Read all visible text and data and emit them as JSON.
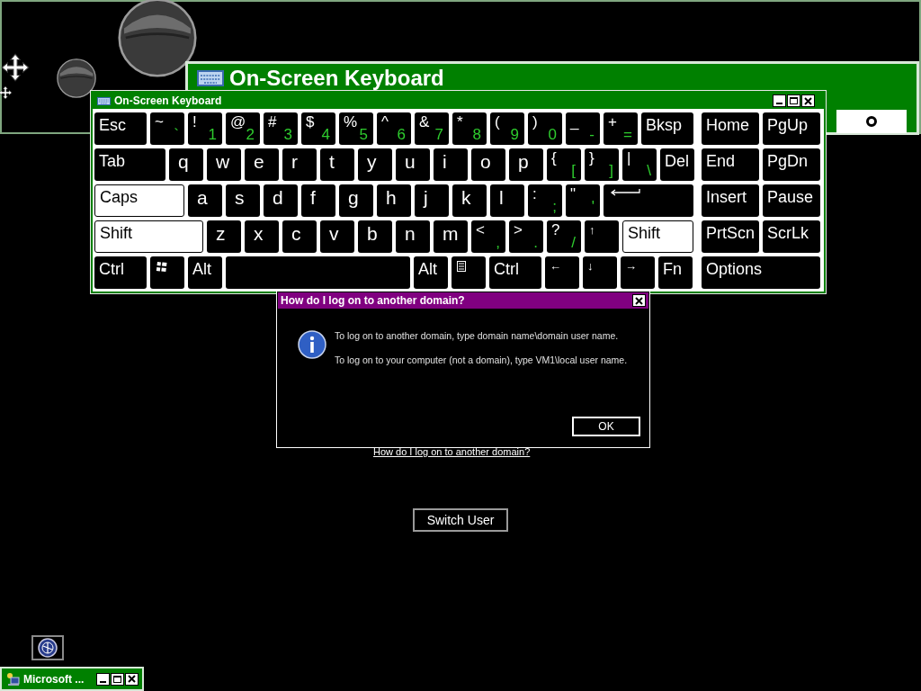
{
  "magnifier": {
    "title": "On-Screen Keyboard"
  },
  "keyboard": {
    "title": "On-Screen Keyboard",
    "main_rows": [
      [
        {
          "kind": "word",
          "label": "Esc",
          "lit": false
        },
        {
          "kind": "dual",
          "shift": "~",
          "base": "`",
          "lit": false
        },
        {
          "kind": "dual",
          "shift": "!",
          "base": "1",
          "lit": false
        },
        {
          "kind": "dual",
          "shift": "@",
          "base": "2",
          "lit": false
        },
        {
          "kind": "dual",
          "shift": "#",
          "base": "3",
          "lit": false
        },
        {
          "kind": "dual",
          "shift": "$",
          "base": "4",
          "lit": false
        },
        {
          "kind": "dual",
          "shift": "%",
          "base": "5",
          "lit": false
        },
        {
          "kind": "dual",
          "shift": "^",
          "base": "6",
          "lit": false
        },
        {
          "kind": "dual",
          "shift": "&",
          "base": "7",
          "lit": false
        },
        {
          "kind": "dual",
          "shift": "*",
          "base": "8",
          "lit": false
        },
        {
          "kind": "dual",
          "shift": "(",
          "base": "9",
          "lit": false
        },
        {
          "kind": "dual",
          "shift": ")",
          "base": "0",
          "lit": false
        },
        {
          "kind": "dual",
          "shift": "_",
          "base": "-",
          "lit": false
        },
        {
          "kind": "dual",
          "shift": "+",
          "base": "=",
          "lit": false
        },
        {
          "kind": "word",
          "label": "Bksp",
          "lit": false
        }
      ],
      [
        {
          "kind": "word",
          "label": "Tab",
          "lit": false
        },
        {
          "kind": "letter",
          "label": "q",
          "lit": false
        },
        {
          "kind": "letter",
          "label": "w",
          "lit": false
        },
        {
          "kind": "letter",
          "label": "e",
          "lit": false
        },
        {
          "kind": "letter",
          "label": "r",
          "lit": false
        },
        {
          "kind": "letter",
          "label": "t",
          "lit": false
        },
        {
          "kind": "letter",
          "label": "y",
          "lit": false
        },
        {
          "kind": "letter",
          "label": "u",
          "lit": false
        },
        {
          "kind": "letter",
          "label": "i",
          "lit": false
        },
        {
          "kind": "letter",
          "label": "o",
          "lit": false
        },
        {
          "kind": "letter",
          "label": "p",
          "lit": false
        },
        {
          "kind": "dual",
          "shift": "{",
          "base": "[",
          "lit": false
        },
        {
          "kind": "dual",
          "shift": "}",
          "base": "]",
          "lit": false
        },
        {
          "kind": "dual",
          "shift": "|",
          "base": "\\",
          "lit": false
        },
        {
          "kind": "word",
          "label": "Del",
          "lit": false
        }
      ],
      [
        {
          "kind": "word",
          "label": "Caps",
          "lit": true
        },
        {
          "kind": "letter",
          "label": "a",
          "lit": false
        },
        {
          "kind": "letter",
          "label": "s",
          "lit": false
        },
        {
          "kind": "letter",
          "label": "d",
          "lit": false
        },
        {
          "kind": "letter",
          "label": "f",
          "lit": false
        },
        {
          "kind": "letter",
          "label": "g",
          "lit": false
        },
        {
          "kind": "letter",
          "label": "h",
          "lit": false
        },
        {
          "kind": "letter",
          "label": "j",
          "lit": false
        },
        {
          "kind": "letter",
          "label": "k",
          "lit": false
        },
        {
          "kind": "letter",
          "label": "l",
          "lit": false
        },
        {
          "kind": "dual",
          "shift": ":",
          "base": ";",
          "lit": false
        },
        {
          "kind": "dual",
          "shift": "\"",
          "base": "'",
          "lit": false
        },
        {
          "kind": "enter",
          "lit": false
        }
      ],
      [
        {
          "kind": "word",
          "label": "Shift",
          "lit": true
        },
        {
          "kind": "letter",
          "label": "z",
          "lit": false
        },
        {
          "kind": "letter",
          "label": "x",
          "lit": false
        },
        {
          "kind": "letter",
          "label": "c",
          "lit": false
        },
        {
          "kind": "letter",
          "label": "v",
          "lit": false
        },
        {
          "kind": "letter",
          "label": "b",
          "lit": false
        },
        {
          "kind": "letter",
          "label": "n",
          "lit": false
        },
        {
          "kind": "letter",
          "label": "m",
          "lit": false
        },
        {
          "kind": "dual",
          "shift": "<",
          "base": ",",
          "lit": false
        },
        {
          "kind": "dual",
          "shift": ">",
          "base": ".",
          "lit": false
        },
        {
          "kind": "dual",
          "shift": "?",
          "base": "/",
          "lit": false
        },
        {
          "kind": "arrow",
          "label": "↑",
          "lit": false
        },
        {
          "kind": "word",
          "label": "Shift",
          "lit": true
        }
      ],
      [
        {
          "kind": "word",
          "label": "Ctrl",
          "lit": false
        },
        {
          "kind": "win",
          "lit": false
        },
        {
          "kind": "word",
          "label": "Alt",
          "lit": false
        },
        {
          "kind": "space",
          "lit": false
        },
        {
          "kind": "word",
          "label": "Alt",
          "lit": false
        },
        {
          "kind": "menu",
          "lit": false
        },
        {
          "kind": "word",
          "label": "Ctrl",
          "lit": false
        },
        {
          "kind": "arrow",
          "label": "←",
          "lit": false
        },
        {
          "kind": "arrow",
          "label": "↓",
          "lit": false
        },
        {
          "kind": "arrow",
          "label": "→",
          "lit": false
        },
        {
          "kind": "word",
          "label": "Fn",
          "lit": false
        }
      ]
    ],
    "side_rows": [
      [
        {
          "kind": "word",
          "label": "Home",
          "lit": false
        },
        {
          "kind": "word",
          "label": "PgUp",
          "lit": false
        }
      ],
      [
        {
          "kind": "word",
          "label": "End",
          "lit": false
        },
        {
          "kind": "word",
          "label": "PgDn",
          "lit": false
        }
      ],
      [
        {
          "kind": "word",
          "label": "Insert",
          "lit": false
        },
        {
          "kind": "word",
          "label": "Pause",
          "lit": false
        }
      ],
      [
        {
          "kind": "word",
          "label": "PrtScn",
          "lit": false
        },
        {
          "kind": "word",
          "label": "ScrLk",
          "lit": false
        }
      ],
      [
        {
          "kind": "word",
          "label": "Options",
          "lit": false
        }
      ]
    ]
  },
  "link": "How do I log on to another domain?",
  "dialog": {
    "title": "How do I log on to another domain?",
    "paragraphs": [
      "To log on to another domain, type domain name\\domain user name.",
      "To log on to your computer (not a domain), type VM1\\local user name."
    ],
    "ok": "OK"
  },
  "switch_user": "Switch User",
  "minimized_window": {
    "title": "Microsoft ..."
  }
}
